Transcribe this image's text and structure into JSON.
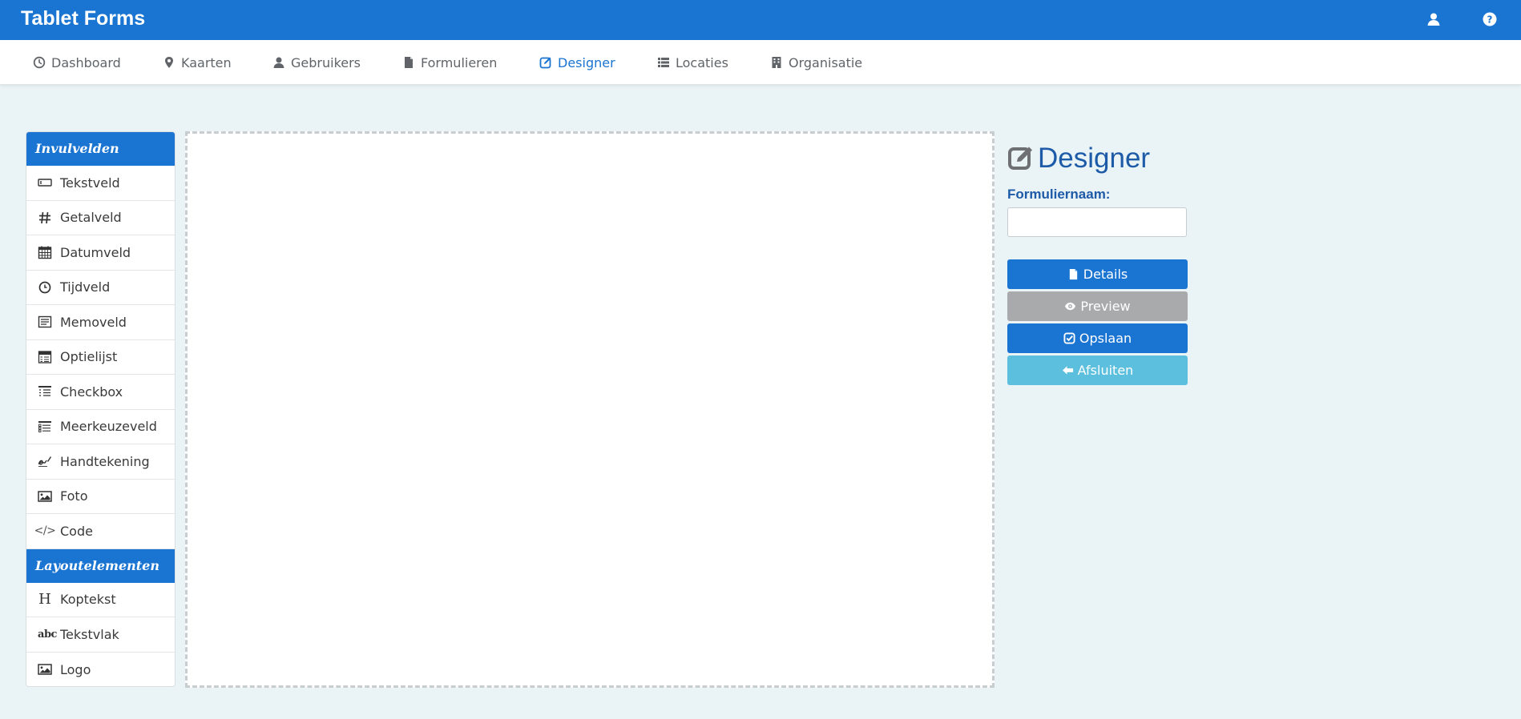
{
  "app": {
    "title": "Tablet Forms"
  },
  "topbar": {
    "user_icon": "user-icon",
    "help_icon": "question-circle-icon"
  },
  "nav": [
    {
      "label": "Dashboard",
      "icon": "dashboard-icon",
      "active": false
    },
    {
      "label": "Kaarten",
      "icon": "map-marker-icon",
      "active": false
    },
    {
      "label": "Gebruikers",
      "icon": "user-icon",
      "active": false
    },
    {
      "label": "Formulieren",
      "icon": "file-icon",
      "active": false
    },
    {
      "label": "Designer",
      "icon": "edit-icon",
      "active": true
    },
    {
      "label": "Locaties",
      "icon": "list-icon",
      "active": false
    },
    {
      "label": "Organisatie",
      "icon": "building-icon",
      "active": false
    }
  ],
  "palette": {
    "fields_header": "Invulvelden",
    "fields": [
      {
        "label": "Tekstveld",
        "icon": "textfield-icon"
      },
      {
        "label": "Getalveld",
        "icon": "hash-icon"
      },
      {
        "label": "Datumveld",
        "icon": "calendar-icon"
      },
      {
        "label": "Tijdveld",
        "icon": "clock-icon"
      },
      {
        "label": "Memoveld",
        "icon": "memo-icon"
      },
      {
        "label": "Optielijst",
        "icon": "option-list-icon"
      },
      {
        "label": "Checkbox",
        "icon": "checkbox-list-icon"
      },
      {
        "label": "Meerkeuzeveld",
        "icon": "multi-choice-icon"
      },
      {
        "label": "Handtekening",
        "icon": "signature-icon"
      },
      {
        "label": "Foto",
        "icon": "image-icon"
      },
      {
        "label": "Code",
        "icon": "code-icon",
        "glyph": "</>"
      }
    ],
    "layout_header": "Layoutelementen",
    "layout": [
      {
        "label": "Koptekst",
        "icon": "heading-icon",
        "glyph": "H"
      },
      {
        "label": "Tekstvlak",
        "icon": "text-block-icon",
        "glyph": "abc"
      },
      {
        "label": "Logo",
        "icon": "image-icon"
      }
    ]
  },
  "designer": {
    "title": "Designer",
    "form_name_label": "Formuliernaam:",
    "form_name_value": "",
    "buttons": {
      "details": "Details",
      "preview": "Preview",
      "save": "Opslaan",
      "close": "Afsluiten"
    }
  },
  "colors": {
    "primary": "#1a74d1",
    "title_blue": "#1d5aa8",
    "preview_gray": "#a8aaac",
    "close_light_blue": "#5bbfdd",
    "background": "#eaf3f6"
  }
}
